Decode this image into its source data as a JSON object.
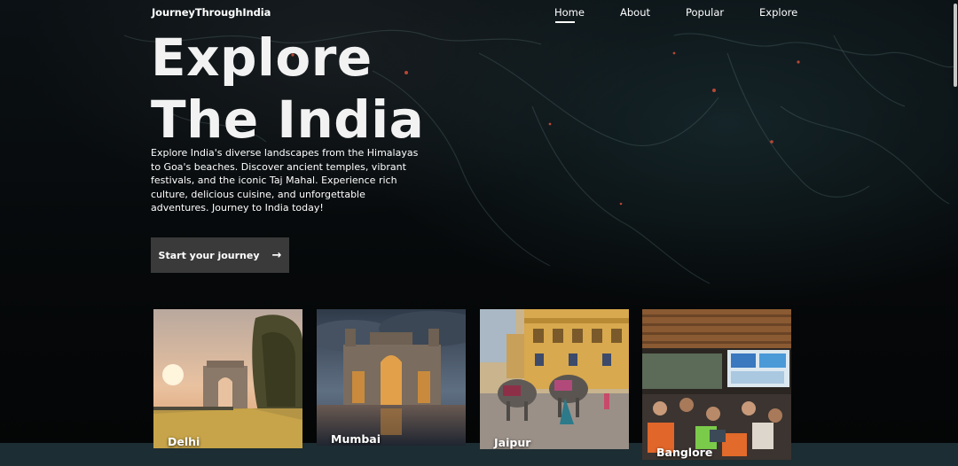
{
  "brand": "JourneyThroughIndia",
  "nav": {
    "items": [
      {
        "label": "Home",
        "active": true
      },
      {
        "label": "About"
      },
      {
        "label": "Popular"
      },
      {
        "label": "Explore"
      }
    ]
  },
  "hero": {
    "title_line1": "Explore",
    "title_line2": "The India",
    "description": "Explore India's diverse landscapes from the Himalayas to Goa's beaches. Discover ancient temples, vibrant festivals, and the iconic Taj Mahal. Experience rich culture, delicious cuisine, and unforgettable adventures. Journey to India today!",
    "cta_label": "Start your journey",
    "cta_icon": "arrow-right-icon"
  },
  "cities": [
    {
      "label": "Delhi"
    },
    {
      "label": "Mumbai"
    },
    {
      "label": "Jaipur"
    },
    {
      "label": "Banglore"
    }
  ],
  "colors": {
    "background": "#05080a",
    "cta_background": "#3a3a3a",
    "bottom_bar": "#1c2d33",
    "text": "#ffffff"
  }
}
